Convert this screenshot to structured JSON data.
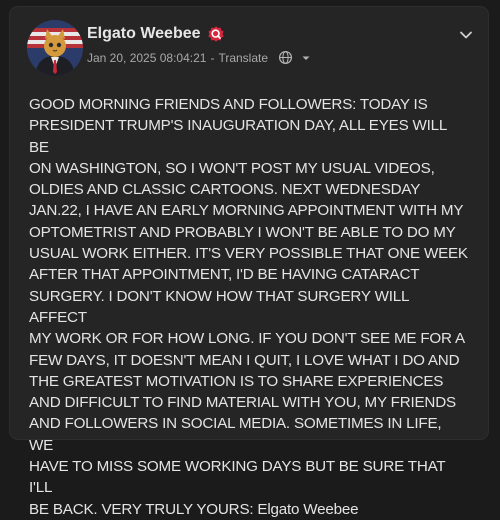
{
  "post": {
    "author_name": "Elgato Weebee",
    "timestamp": "Jan 20, 2025 08:04:21",
    "separator": "-",
    "translate_label": "Translate",
    "text": "GOOD MORNING FRIENDS AND FOLLOWERS: TODAY IS\nPRESIDENT TRUMP'S INAUGURATION DAY, ALL EYES WILL BE\nON WASHINGTON, SO I WON'T POST MY USUAL VIDEOS,\nOLDIES AND CLASSIC CARTOONS. NEXT WEDNESDAY\nJAN.22, I HAVE AN EARLY MORNING APPOINTMENT WITH MY\nOPTOMETRIST AND PROBABLY I WON'T BE ABLE TO DO MY\nUSUAL WORK EITHER. IT'S VERY POSSIBLE THAT ONE WEEK\nAFTER THAT APPOINTMENT, I'D BE HAVING CATARACT\nSURGERY. I DON'T KNOW HOW THAT SURGERY WILL AFFECT\nMY WORK OR FOR HOW LONG. IF YOU DON'T SEE ME FOR A\nFEW DAYS, IT DOESN'T MEAN I QUIT, I LOVE WHAT I DO AND\nTHE GREATEST MOTIVATION IS TO SHARE EXPERIENCES\nAND DIFFICULT TO FIND MATERIAL WITH YOU, MY FRIENDS\nAND FOLLOWERS IN SOCIAL MEDIA. SOMETIMES IN LIFE, WE\nHAVE TO MISS SOME WORKING DAYS BUT BE SURE THAT I'LL\nBE BACK. VERY TRULY YOURS: Elgato Weebee"
  },
  "icons": {
    "verified": "verified-badge-icon",
    "globe": "globe-icon",
    "caret": "caret-down-icon",
    "menu": "chevron-down-icon"
  },
  "colors": {
    "background": "#1b1b1c",
    "card": "#252526",
    "verified_badge": "#d7263d",
    "text": "#e4e4e4",
    "meta": "#a8a8a8"
  }
}
